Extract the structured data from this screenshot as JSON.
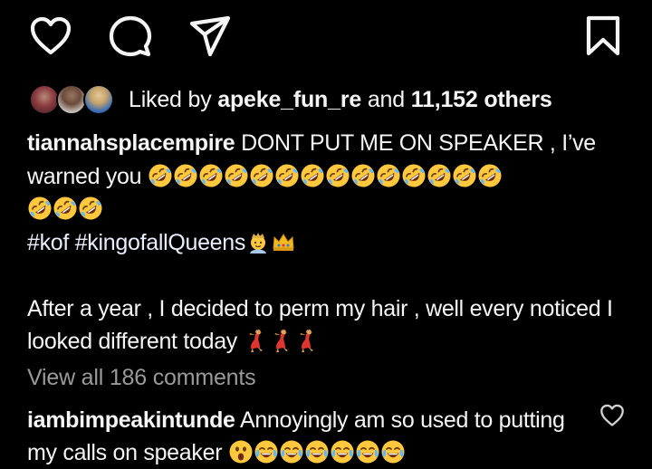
{
  "actions": {
    "like_icon": "heart-outline-icon",
    "comment_icon": "comment-bubble-icon",
    "share_icon": "paper-plane-icon",
    "save_icon": "bookmark-outline-icon"
  },
  "likes": {
    "prefix": "Liked by",
    "user": "apeke_fun_re",
    "joiner": "and",
    "others": "11,152 others"
  },
  "post": {
    "username": "tiannahsplacempire",
    "caption_line1": "DONT PUT ME ON SPEAKER , I’ve",
    "caption_line2": "warned you",
    "laughing_emoji_count": 17,
    "hashtags": "#kof #kingofallQueens",
    "paragraph": "After a year , I decided to perm my hair , well every noticed I looked different today",
    "dancer_emoji_count": 3
  },
  "comments": {
    "view_all": "View all 186 comments",
    "top": {
      "username": "iambimpeakintunde",
      "text": "Annoyingly am so used to putting my calls on speaker",
      "emojis": [
        "astonished",
        "tears-of-joy",
        "tears-of-joy",
        "tears-of-joy",
        "tears-of-joy",
        "tears-of-joy",
        "tears-of-joy"
      ]
    }
  },
  "colors": {
    "background": "#000000",
    "text": "#f5f5f5",
    "muted": "#9a9a9a",
    "emoji_yellow": "#ffc83d"
  }
}
